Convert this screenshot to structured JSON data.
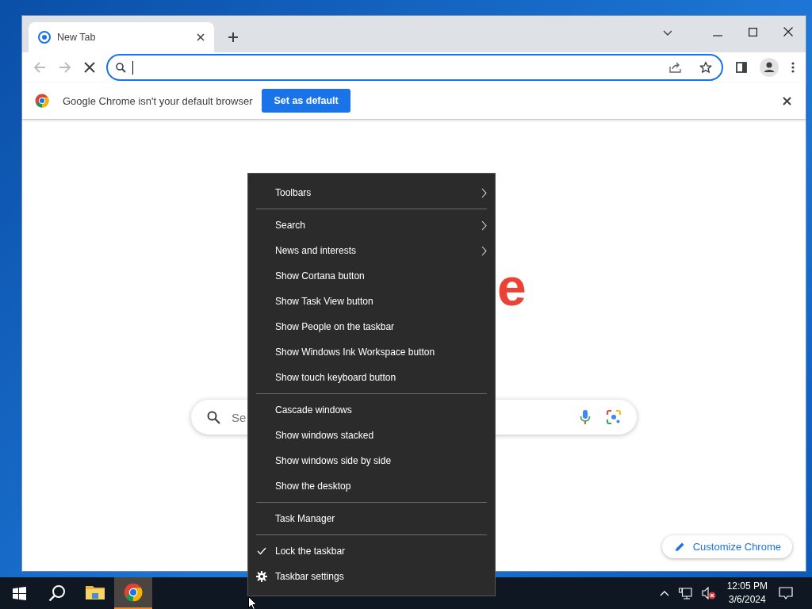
{
  "browser": {
    "tabs": [
      {
        "title": "New Tab",
        "selected": true
      }
    ],
    "omnibox": {
      "focused": true
    },
    "infobar": {
      "message": "Google Chrome isn't your default browser",
      "button": "Set as default"
    },
    "new_tab_page": {
      "logo_text": "e",
      "search_placeholder": "Se",
      "customize_button": "Customize Chrome"
    }
  },
  "context_menu": {
    "groups": [
      [
        {
          "label": "Toolbars",
          "kind": "item",
          "submenu": true,
          "checked": false
        }
      ],
      [
        {
          "label": "Search",
          "kind": "item",
          "submenu": true,
          "checked": false
        },
        {
          "label": "News and interests",
          "kind": "item",
          "submenu": true,
          "checked": false
        },
        {
          "label": "Show Cortana button",
          "kind": "item",
          "submenu": false,
          "checked": false
        },
        {
          "label": "Show Task View button",
          "kind": "item",
          "submenu": false,
          "checked": false
        },
        {
          "label": "Show People on the taskbar",
          "kind": "item",
          "submenu": false,
          "checked": false
        },
        {
          "label": "Show Windows Ink Workspace button",
          "kind": "item",
          "submenu": false,
          "checked": false
        },
        {
          "label": "Show touch keyboard button",
          "kind": "item",
          "submenu": false,
          "checked": false
        }
      ],
      [
        {
          "label": "Cascade windows",
          "kind": "item",
          "submenu": false,
          "checked": false
        },
        {
          "label": "Show windows stacked",
          "kind": "item",
          "submenu": false,
          "checked": false
        },
        {
          "label": "Show windows side by side",
          "kind": "item",
          "submenu": false,
          "checked": false
        },
        {
          "label": "Show the desktop",
          "kind": "item",
          "submenu": false,
          "checked": false
        }
      ],
      [
        {
          "label": "Task Manager",
          "kind": "item",
          "submenu": false,
          "checked": false
        }
      ],
      [
        {
          "label": "Lock the taskbar",
          "kind": "item",
          "submenu": false,
          "checked": true
        },
        {
          "label": "Taskbar settings",
          "kind": "settings",
          "submenu": false,
          "checked": false
        }
      ]
    ]
  },
  "taskbar": {
    "apps": [
      {
        "kind": "files",
        "selected": false
      },
      {
        "kind": "chrome",
        "selected": true
      }
    ],
    "clock": {
      "time": "12:05 PM",
      "date": "3/6/2024"
    }
  }
}
